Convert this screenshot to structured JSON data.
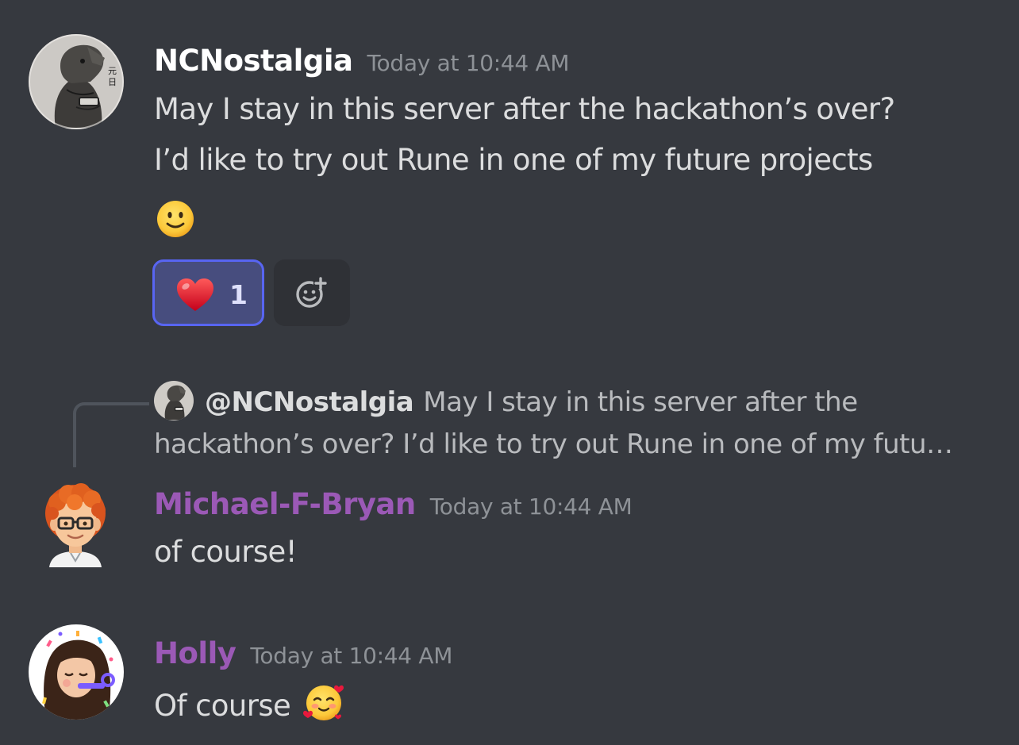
{
  "messages": [
    {
      "username": "NCNostalgia",
      "username_color": "#ffffff",
      "timestamp": "Today at 10:44 AM",
      "lines": [
        "May I stay in this server after the hackathon’s over?",
        "I’d like to try out Rune in one of my future projects"
      ],
      "emoji": "slightly-smiling-face",
      "reactions": [
        {
          "emoji": "red-heart",
          "count": "1",
          "active": true
        }
      ],
      "add_reaction_icon": "add-reaction-icon"
    },
    {
      "username": "Michael-F-Bryan",
      "username_color": "#9b59b6",
      "timestamp": "Today at 10:44 AM",
      "reply": {
        "username": "@NCNostalgia",
        "text": "May I stay in this server after the hackathon’s over? I’d like to try out Rune in one of my futu…"
      },
      "text": "of course!"
    },
    {
      "username": "Holly",
      "username_color": "#9b59b6",
      "timestamp": "Today at 10:44 AM",
      "text": "Of course",
      "emoji": "smiling-face-with-hearts"
    }
  ],
  "colors": {
    "background": "#36393f",
    "text": "#dcddde",
    "muted": "#8e9297",
    "reaction_active_bg": "#474d7e",
    "reaction_active_border": "#5865f2"
  }
}
